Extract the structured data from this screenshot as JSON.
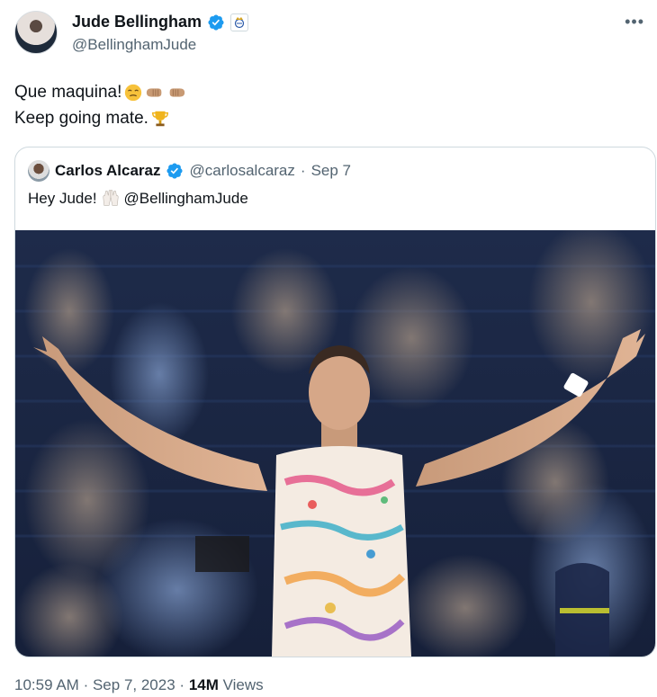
{
  "author": {
    "display_name": "Jude Bellingham",
    "handle": "@BellinghamJude"
  },
  "tweet": {
    "line1": "Que maquina!",
    "line2": "Keep going mate."
  },
  "quoted": {
    "display_name": "Carlos Alcaraz",
    "handle": "@carlosalcaraz",
    "separator": "·",
    "date": "Sep 7",
    "text_prefix": "Hey Jude!",
    "mention": "@BellinghamJude"
  },
  "footer": {
    "time": "10:59 AM",
    "separator1": "·",
    "date": "Sep 7, 2023",
    "separator2": "·",
    "views_count": "14M",
    "views_label": "Views"
  },
  "icons": {
    "verified": "verified-badge-icon",
    "club": "real-madrid-crest-icon",
    "more": "more-options-icon",
    "relieved_face": "relieved-face-emoji",
    "fist_left": "left-fist-emoji",
    "fist_right": "right-fist-emoji",
    "trophy": "trophy-emoji",
    "raised_hands": "raised-hands-emoji"
  },
  "colors": {
    "verified_blue": "#1d9bf0",
    "muted_text": "#536471",
    "main_text": "#0f1419",
    "border": "#cfd9de"
  }
}
